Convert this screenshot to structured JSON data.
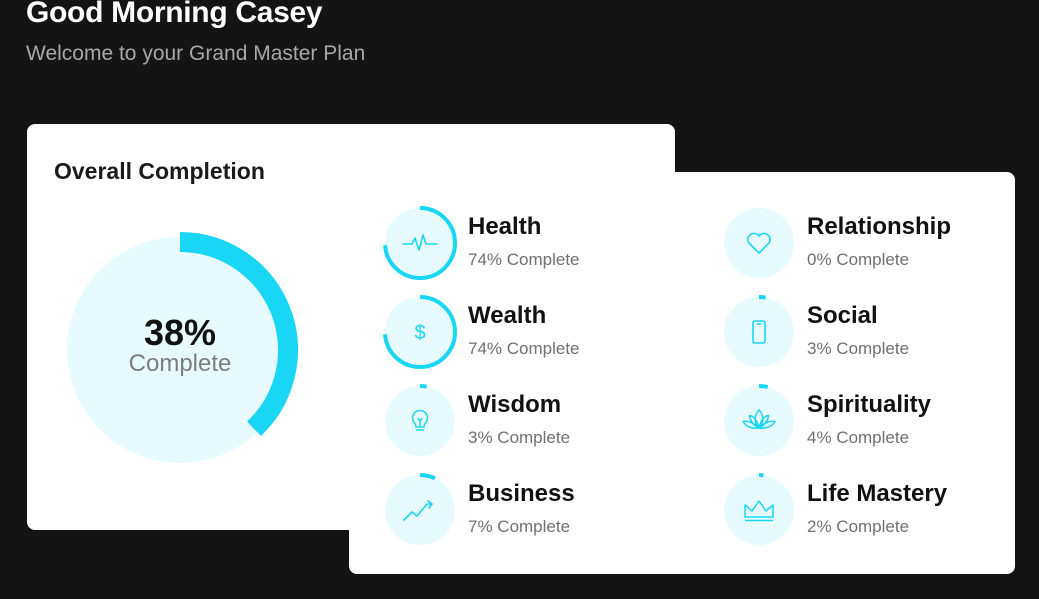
{
  "header": {
    "greeting": "Good Morning Casey",
    "subtitle": "Welcome to your Grand Master Plan"
  },
  "overall": {
    "title": "Overall Completion",
    "percent_label": "38%",
    "complete_label": "Complete",
    "percent_value": 38
  },
  "colors": {
    "accent": "#1ad6f5",
    "circle_bg": "#e7fafd",
    "page_bg": "#141414"
  },
  "categories": [
    {
      "name": "Health",
      "status": "74% Complete",
      "percent": 74,
      "icon": "heartbeat-icon"
    },
    {
      "name": "Relationship",
      "status": "0% Complete",
      "percent": 0,
      "icon": "heart-icon"
    },
    {
      "name": "Wealth",
      "status": "74% Complete",
      "percent": 74,
      "icon": "dollar-icon"
    },
    {
      "name": "Social",
      "status": "3% Complete",
      "percent": 3,
      "icon": "phone-icon"
    },
    {
      "name": "Wisdom",
      "status": "3% Complete",
      "percent": 3,
      "icon": "lightbulb-icon"
    },
    {
      "name": "Spirituality",
      "status": "4% Complete",
      "percent": 4,
      "icon": "lotus-icon"
    },
    {
      "name": "Business",
      "status": "7% Complete",
      "percent": 7,
      "icon": "trending-up-icon"
    },
    {
      "name": "Life Mastery",
      "status": "2% Complete",
      "percent": 2,
      "icon": "crown-icon"
    }
  ]
}
